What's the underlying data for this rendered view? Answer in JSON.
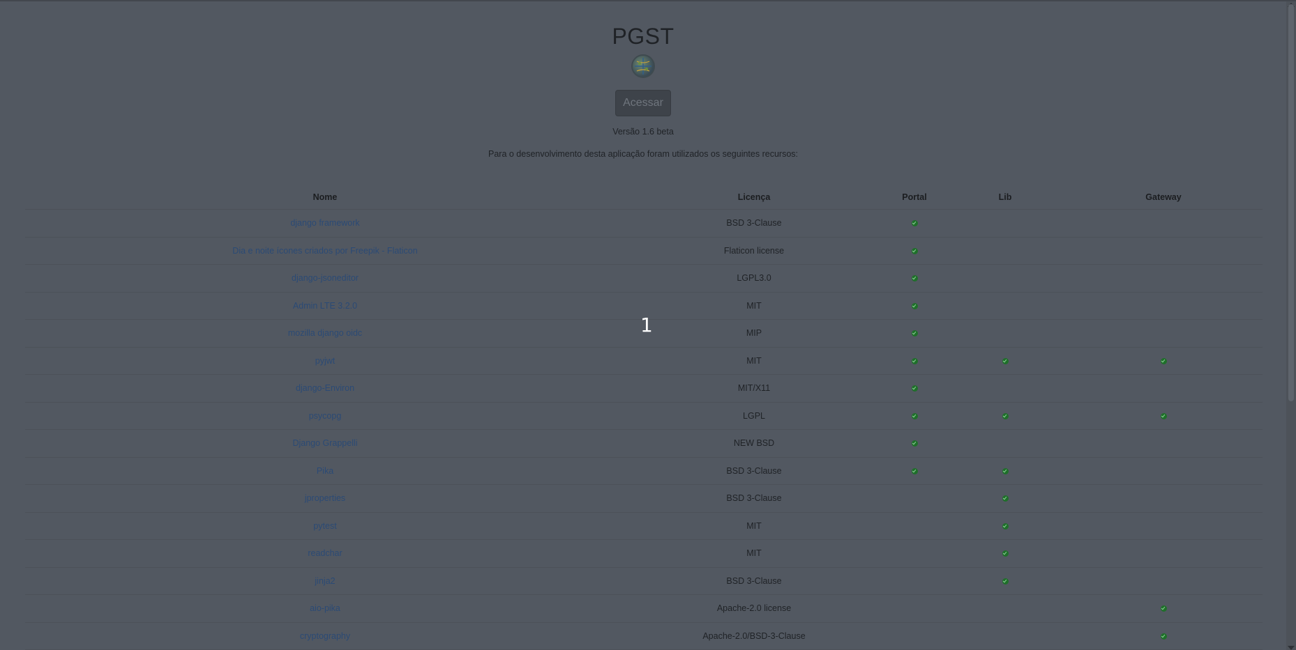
{
  "header": {
    "title": "PGST",
    "access_label": "Acessar",
    "version": "Versão 1.6 beta",
    "intro": "Para o desenvolvimento desta aplicação foram utilizados os seguintes recursos:"
  },
  "table": {
    "columns": [
      "Nome",
      "Licença",
      "Portal",
      "Lib",
      "Gateway"
    ],
    "rows": [
      {
        "name": "django framework",
        "license": "BSD 3-Clause",
        "portal": true,
        "lib": false,
        "gateway": false
      },
      {
        "name": "Dia e noite ícones criados por Freepik - Flaticon",
        "license": "Flaticon license",
        "portal": true,
        "lib": false,
        "gateway": false
      },
      {
        "name": "django-jsoneditor",
        "license": "LGPL3.0",
        "portal": true,
        "lib": false,
        "gateway": false
      },
      {
        "name": "Admin LTE 3.2.0",
        "license": "MIT",
        "portal": true,
        "lib": false,
        "gateway": false
      },
      {
        "name": "mozilla django oidc",
        "license": "MIP",
        "portal": true,
        "lib": false,
        "gateway": false
      },
      {
        "name": "pyjwt",
        "license": "MIT",
        "portal": true,
        "lib": true,
        "gateway": true
      },
      {
        "name": "django-Environ",
        "license": "MIT/X11",
        "portal": true,
        "lib": false,
        "gateway": false
      },
      {
        "name": "psycopg",
        "license": "LGPL",
        "portal": true,
        "lib": true,
        "gateway": true
      },
      {
        "name": "Django Grappelli",
        "license": "NEW BSD",
        "portal": true,
        "lib": false,
        "gateway": false
      },
      {
        "name": "Pika",
        "license": "BSD 3-Clause",
        "portal": true,
        "lib": true,
        "gateway": false
      },
      {
        "name": "jproperties",
        "license": "BSD 3-Clause",
        "portal": false,
        "lib": true,
        "gateway": false
      },
      {
        "name": "pytest",
        "license": "MIT",
        "portal": false,
        "lib": true,
        "gateway": false
      },
      {
        "name": "readchar",
        "license": "MIT",
        "portal": false,
        "lib": true,
        "gateway": false
      },
      {
        "name": "jinja2",
        "license": "BSD 3-Clause",
        "portal": false,
        "lib": true,
        "gateway": false
      },
      {
        "name": "aio-pika",
        "license": "Apache-2.0 license",
        "portal": false,
        "lib": false,
        "gateway": true
      },
      {
        "name": "cryptography",
        "license": "Apache-2.0/BSD-3-Clause",
        "portal": false,
        "lib": false,
        "gateway": true
      }
    ]
  },
  "overlay": {
    "number": "1"
  },
  "icons": {
    "check": "check-circle-icon",
    "logo": "globe-logo-icon"
  },
  "colors": {
    "background": "#525861",
    "link": "#2b4a75",
    "check": "#1f6f2a"
  }
}
